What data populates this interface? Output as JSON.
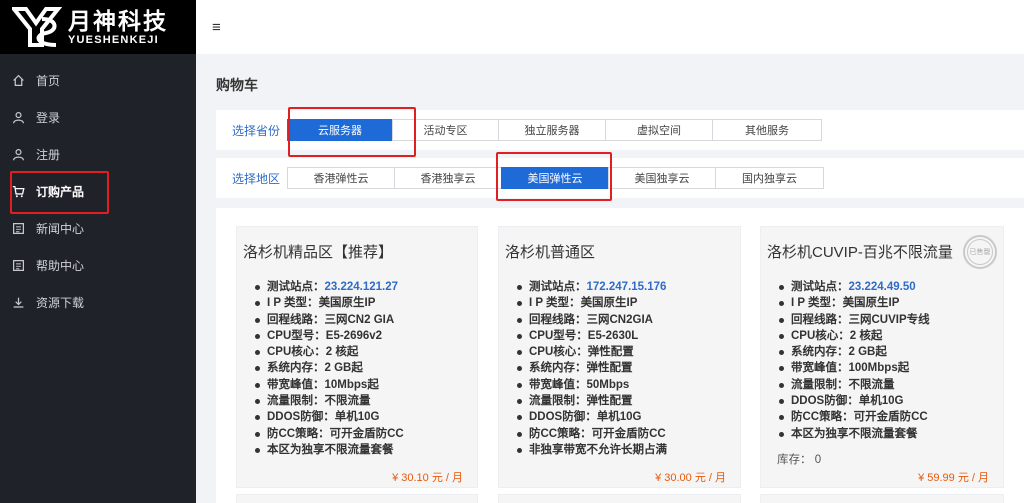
{
  "brand": {
    "name_cn": "月神科技",
    "name_en": "YUESHENKEJI"
  },
  "sidebar": {
    "items": [
      {
        "label": "首页",
        "icon": "home-icon"
      },
      {
        "label": "登录",
        "icon": "user-icon"
      },
      {
        "label": "注册",
        "icon": "user-add-icon"
      },
      {
        "label": "订购产品",
        "icon": "cart-icon",
        "active": true
      },
      {
        "label": "新闻中心",
        "icon": "news-icon"
      },
      {
        "label": "帮助中心",
        "icon": "help-icon"
      },
      {
        "label": "资源下载",
        "icon": "download-icon"
      }
    ]
  },
  "header": {
    "menu_icon": "≡"
  },
  "page": {
    "title": "购物车"
  },
  "filters": {
    "province": {
      "label": "选择省份",
      "options": [
        "云服务器",
        "活动专区",
        "独立服务器",
        "虚拟空间",
        "其他服务"
      ],
      "selected": "云服务器"
    },
    "region": {
      "label": "选择地区",
      "options": [
        "香港弹性云",
        "香港独享云",
        "美国弹性云",
        "美国独享云",
        "国内独享云"
      ],
      "selected": "美国弹性云"
    }
  },
  "products": [
    {
      "title": "洛杉机精品区【推荐】",
      "specs": [
        {
          "label": "测试站点：",
          "value": "23.224.121.27",
          "link": true
        },
        {
          "label": "I P 类型：",
          "value": "美国原生IP"
        },
        {
          "label": "回程线路：",
          "value": "三网CN2 GIA"
        },
        {
          "label": "CPU型号：",
          "value": "E5-2696v2"
        },
        {
          "label": "CPU核心：",
          "value": "2 核起"
        },
        {
          "label": "系统内存：",
          "value": "2 GB起"
        },
        {
          "label": "带宽峰值：",
          "value": "10Mbps起"
        },
        {
          "label": "流量限制：",
          "value": "不限流量"
        },
        {
          "label": "DDOS防御：",
          "value": "单机10G"
        },
        {
          "label": "防CC策略：",
          "value": "可开金盾防CC"
        },
        {
          "label": "",
          "value": "本区为独享不限流量套餐"
        }
      ],
      "price": "¥ 30.10 元 / 月"
    },
    {
      "title": "洛杉机普通区",
      "specs": [
        {
          "label": "测试站点：",
          "value": "172.247.15.176",
          "link": true
        },
        {
          "label": "I P 类型：",
          "value": "美国原生IP"
        },
        {
          "label": "回程线路：",
          "value": "三网CN2GIA"
        },
        {
          "label": "CPU型号：",
          "value": "E5-2630L"
        },
        {
          "label": "CPU核心：",
          "value": "弹性配置"
        },
        {
          "label": "系统内存：",
          "value": "弹性配置"
        },
        {
          "label": "带宽峰值：",
          "value": "50Mbps"
        },
        {
          "label": "流量限制：",
          "value": "弹性配置"
        },
        {
          "label": "DDOS防御：",
          "value": "单机10G"
        },
        {
          "label": "防CC策略：",
          "value": "可开金盾防CC"
        },
        {
          "label": "",
          "value": "非独享带宽不允许长期占满"
        }
      ],
      "price": "¥ 30.00 元 / 月"
    },
    {
      "title": "洛杉机CUVIP-百兆不限流量",
      "badge": "已售罄",
      "specs": [
        {
          "label": "测试站点：",
          "value": "23.224.49.50",
          "link": true
        },
        {
          "label": "I P 类型：",
          "value": "美国原生IP"
        },
        {
          "label": "回程线路：",
          "value": "三网CUVIP专线"
        },
        {
          "label": "CPU核心：",
          "value": "2 核起"
        },
        {
          "label": "系统内存：",
          "value": "2 GB起"
        },
        {
          "label": "带宽峰值：",
          "value": "100Mbps起"
        },
        {
          "label": "流量限制：",
          "value": "不限流量"
        },
        {
          "label": "DDOS防御：",
          "value": "单机10G"
        },
        {
          "label": "防CC策略：",
          "value": "可开金盾防CC"
        },
        {
          "label": "",
          "value": "本区为独享不限流量套餐"
        }
      ],
      "stock": "库存：  0",
      "price": "¥ 59.99 元 / 月"
    }
  ],
  "colors": {
    "sidebar_bg": "#20222a",
    "accent": "#1e6ad6",
    "link": "#2f6cc8",
    "price": "#e8590c",
    "highlight_box": "#e02020"
  }
}
